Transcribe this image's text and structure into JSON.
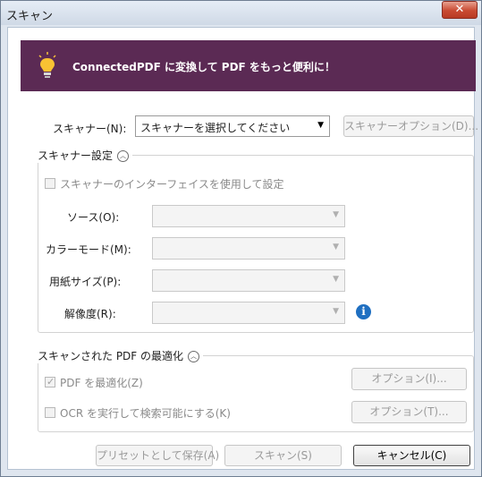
{
  "window": {
    "title": "スキャン",
    "close_glyph": "✕"
  },
  "banner": {
    "text": "ConnectedPDF に変換して PDF をもっと便利に！",
    "icon": "lightbulb-icon",
    "bg_color": "#5b2a54"
  },
  "scanner": {
    "label": "スキャナー(N):",
    "selected": "スキャナーを選択してください",
    "options_button": "スキャナーオプション(D)..."
  },
  "settings": {
    "title": "スキャナー設定",
    "use_interface_label": "スキャナーのインターフェイスを使用して設定",
    "source_label": "ソース(O):",
    "color_mode_label": "カラーモード(M):",
    "paper_size_label": "用紙サイズ(P):",
    "resolution_label": "解像度(R):",
    "info_glyph": "i"
  },
  "optimize": {
    "title": "スキャンされた PDF の最適化",
    "optimize_pdf_label": "PDF を最適化(Z)",
    "optimize_pdf_checked": true,
    "optimize_options_button": "オプション(I)...",
    "ocr_label": "OCR を実行して検索可能にする(K)",
    "ocr_checked": false,
    "ocr_options_button": "オプション(T)..."
  },
  "footer": {
    "save_preset_button": "プリセットとして保存(A)",
    "scan_button": "スキャン(S)",
    "cancel_button": "キャンセル(C)"
  }
}
